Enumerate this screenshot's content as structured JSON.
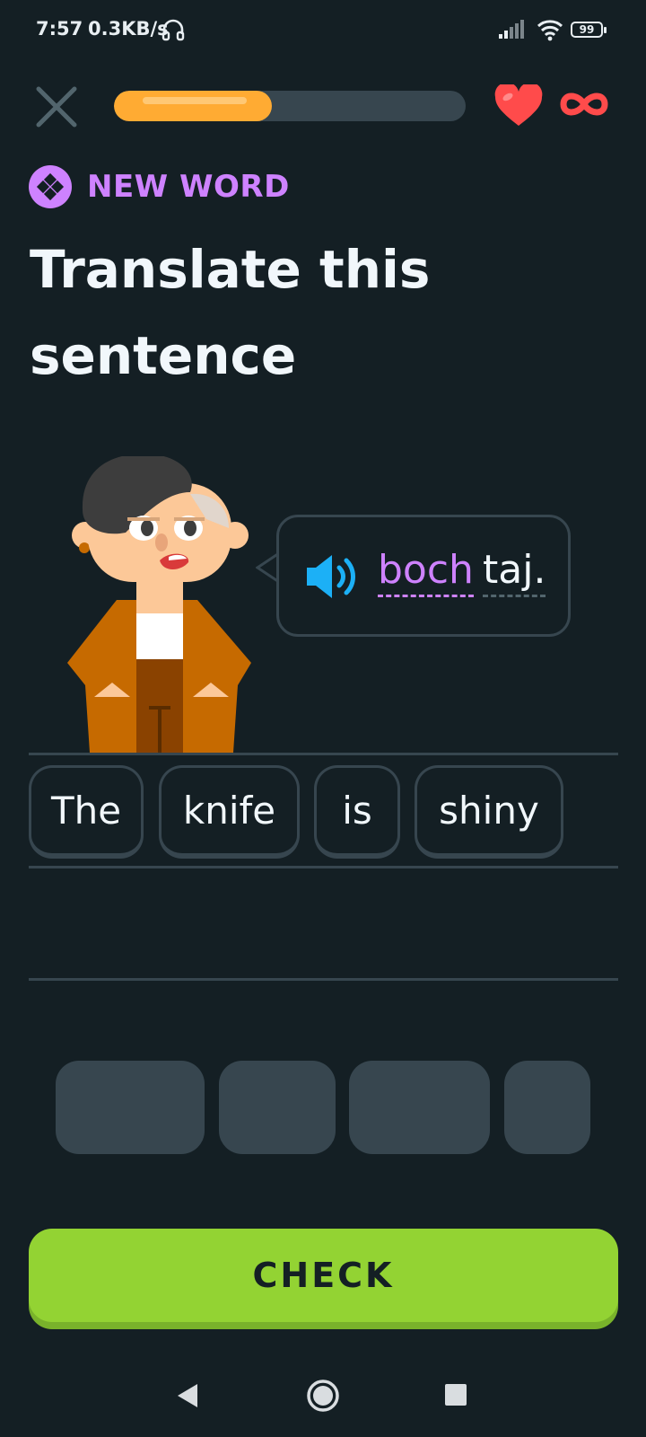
{
  "status_bar": {
    "time": "7:57",
    "net_speed": "0.3KB/s",
    "battery": "99",
    "icons": [
      "headset-icon",
      "signal-icon",
      "wifi-icon",
      "battery-icon"
    ]
  },
  "lesson_bar": {
    "progress": 0.45,
    "progress_color": "#ffab33",
    "hearts": "∞",
    "heart_color": "#ff4b4b"
  },
  "header": {
    "badge": "NEW WORD",
    "badge_color": "#ce82ff",
    "title": "Translate this sentence"
  },
  "prompt": {
    "words": [
      {
        "text": "boch",
        "highlight": true,
        "color": "#ce82ff"
      },
      {
        "text": "taj.",
        "highlight": false
      }
    ],
    "icon": "speaker-icon"
  },
  "answer_words": [
    "The",
    "knife",
    "is",
    "shiny"
  ],
  "word_bank_slots": 4,
  "check_button": {
    "label": "CHECK",
    "color": "#93d333"
  },
  "nav": [
    "back-icon",
    "home-icon",
    "recents-icon"
  ]
}
